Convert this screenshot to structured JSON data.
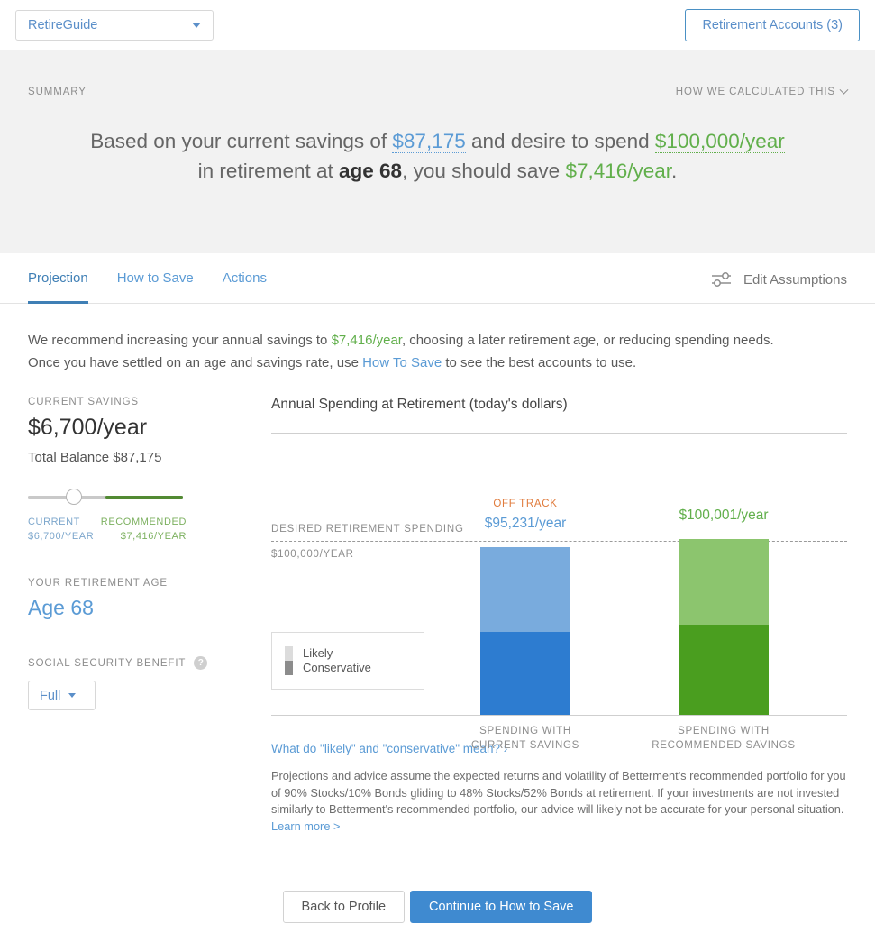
{
  "topbar": {
    "guide_selector_label": "RetireGuide",
    "accounts_button_label": "Retirement Accounts (3)"
  },
  "summary": {
    "section_label": "SUMMARY",
    "how_calculated_label": "HOW WE CALCULATED THIS",
    "sentence": {
      "part1": "Based on your current savings of ",
      "current_savings": "$87,175",
      "part2": " and desire to spend ",
      "desired_spending": "$100,000/year",
      "part3": "in retirement at ",
      "age": "age 68",
      "part4": ", you should save ",
      "recommended_savings": "$7,416/year",
      "part5": "."
    }
  },
  "tabs": [
    {
      "label": "Projection",
      "active": true
    },
    {
      "label": "How to Save",
      "active": false
    },
    {
      "label": "Actions",
      "active": false
    }
  ],
  "edit_assumptions_label": "Edit Assumptions",
  "recommendation": {
    "line1_part1": "We recommend increasing your annual savings to ",
    "line1_amount": "$7,416/year",
    "line1_part2": ", choosing a later retirement age, or reducing spending needs.",
    "line2_part1": "Once you have settled on an age and savings rate, use ",
    "line2_link": "How To Save",
    "line2_part2": " to see the best accounts to use."
  },
  "sidebar": {
    "current_savings_label": "CURRENT SAVINGS",
    "current_savings_value": "$6,700/year",
    "total_balance": "Total Balance $87,175",
    "slider": {
      "current_label": "CURRENT",
      "current_value": "$6,700/YEAR",
      "recommended_label": "RECOMMENDED",
      "recommended_value": "$7,416/YEAR",
      "position_percent": 30
    },
    "retirement_age_label": "YOUR RETIREMENT AGE",
    "retirement_age_value": "Age 68",
    "social_security_label": "SOCIAL SECURITY BENEFIT",
    "social_security_help": "?",
    "social_security_value": "Full"
  },
  "chart_data": {
    "type": "bar",
    "title": "Annual Spending at Retirement (today's dollars)",
    "xlabel": "",
    "ylabel": "",
    "stacked": true,
    "categories": [
      "SPENDING WITH CURRENT SAVINGS",
      "SPENDING WITH RECOMMENDED SAVINGS"
    ],
    "category_lines": [
      [
        "SPENDING WITH",
        "CURRENT SAVINGS"
      ],
      [
        "SPENDING WITH",
        "RECOMMENDED SAVINGS"
      ]
    ],
    "series": [
      {
        "name": "Likely",
        "values": [
          95231,
          100001
        ]
      },
      {
        "name": "Conservative",
        "values": [
          44500,
          47000
        ]
      }
    ],
    "bar_value_labels": [
      "$95,231/year",
      "$100,001/year"
    ],
    "status_badges": [
      "OFF TRACK",
      ""
    ],
    "reference_line": {
      "label": "DESIRED RETIREMENT SPENDING",
      "axis_label": "$100,000/YEAR",
      "value": 100000,
      "style": "dashed"
    },
    "legend": {
      "position": "inside-left",
      "entries": [
        {
          "label": "Likely",
          "color": "#dcdcdc"
        },
        {
          "label": "Conservative",
          "color": "#8c8c8c"
        }
      ]
    },
    "colors": {
      "current_likely": "#79abdd",
      "current_conservative": "#2d7cd0",
      "recommended_likely": "#8cc56e",
      "recommended_conservative": "#4a9e1f",
      "off_track": "#e07b3c"
    },
    "ylim": [
      0,
      111000
    ],
    "grid": false
  },
  "chart_footer": {
    "meaning_link": "What do \"likely\" and \"conservative\" mean? ›",
    "disclaimer": "Projections and advice assume the expected returns and volatility of Betterment's recommended portfolio for you of 90% Stocks/10% Bonds gliding to 48% Stocks/52% Bonds at retirement. If your investments are not invested similarly to Betterment's recommended portfolio, our advice will likely not be accurate for your personal situation.",
    "learn_more": "Learn more >"
  },
  "footer": {
    "back_label": "Back to Profile",
    "continue_label": "Continue to How to Save"
  }
}
